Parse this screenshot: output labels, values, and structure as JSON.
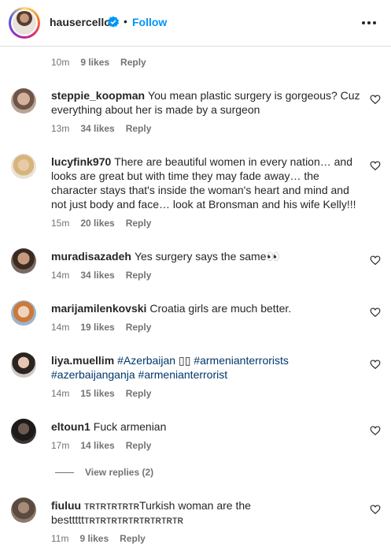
{
  "header": {
    "username": "hausercello",
    "follow_label": "Follow",
    "dot": "•"
  },
  "top_meta": {
    "time": "10m",
    "likes": "9 likes",
    "reply": "Reply"
  },
  "comments": [
    {
      "username": "steppie_koopman",
      "text": "You mean plastic surgery is gorgeous? Cuz everything about her is made by a surgeon",
      "time": "13m",
      "likes": "34 likes",
      "reply": "Reply"
    },
    {
      "username": "lucyfink970",
      "text": "There are beautiful women in every nation… and looks are great but with time they may fade away… the character stays that's inside the woman's heart and mind and not just body and face… look at Bronsman and his wife Kelly!!!",
      "time": "15m",
      "likes": "20 likes",
      "reply": "Reply"
    },
    {
      "username": "muradisazadeh",
      "text": "Yes surgery says the same👀",
      "time": "14m",
      "likes": "34 likes",
      "reply": "Reply"
    },
    {
      "username": "marijamilenkovski",
      "text": "Croatia girls are much better.",
      "time": "14m",
      "likes": "19 likes",
      "reply": "Reply"
    },
    {
      "username": "liya.muellim",
      "hashtag1": "#Azerbaijan",
      "flags": "▯▯",
      "hashtag2": "#armenianterrorists",
      "hashtag3": "#azerbaijanganja",
      "hashtag4": "#armenianterrorist",
      "time": "14m",
      "likes": "15 likes",
      "reply": "Reply"
    },
    {
      "username": "eltoun1",
      "text": "Fuck armenian",
      "time": "17m",
      "likes": "14 likes",
      "reply": "Reply"
    },
    {
      "username": "fiuluu",
      "text": "ᴛʀᴛʀᴛʀᴛʀᴛʀTurkish woman are the bestttttᴛʀᴛʀᴛʀᴛʀᴛʀᴛʀᴛʀᴛʀᴛʀ",
      "time": "11m",
      "likes": "9 likes",
      "reply": "Reply"
    }
  ],
  "view_replies": "View replies (2)",
  "colors": {
    "link": "#0095f6",
    "hashtag": "#00376b",
    "muted": "#737373",
    "text": "#262626"
  },
  "icons": [
    "verified-badge-icon",
    "more-options-icon",
    "heart-icon"
  ]
}
